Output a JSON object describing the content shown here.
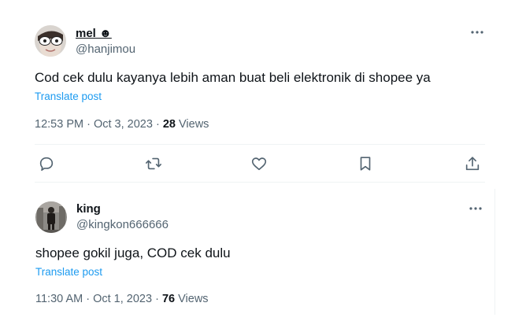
{
  "tweet1": {
    "display_name": "mel ☻",
    "handle": "@hanjimou",
    "text": "Cod cek dulu kayanya lebih aman buat beli elektronik di shopee ya",
    "translate_label": "Translate post",
    "time": "12:53 PM",
    "date": "Oct 3, 2023",
    "views_count": "28",
    "views_label": "Views",
    "actions": [
      "reply-icon",
      "retweet-icon",
      "like-icon",
      "bookmark-icon",
      "share-icon"
    ]
  },
  "tweet2": {
    "display_name": "king",
    "handle": "@kingkon666666",
    "text": "shopee gokil juga, COD cek dulu",
    "translate_label": "Translate post",
    "time": "11:30 AM",
    "date": "Oct 1, 2023",
    "views_count": "76",
    "views_label": "Views"
  },
  "colors": {
    "text": "#0f1419",
    "secondary": "#536471",
    "link": "#1d9bf0",
    "divider": "#eff3f4"
  }
}
